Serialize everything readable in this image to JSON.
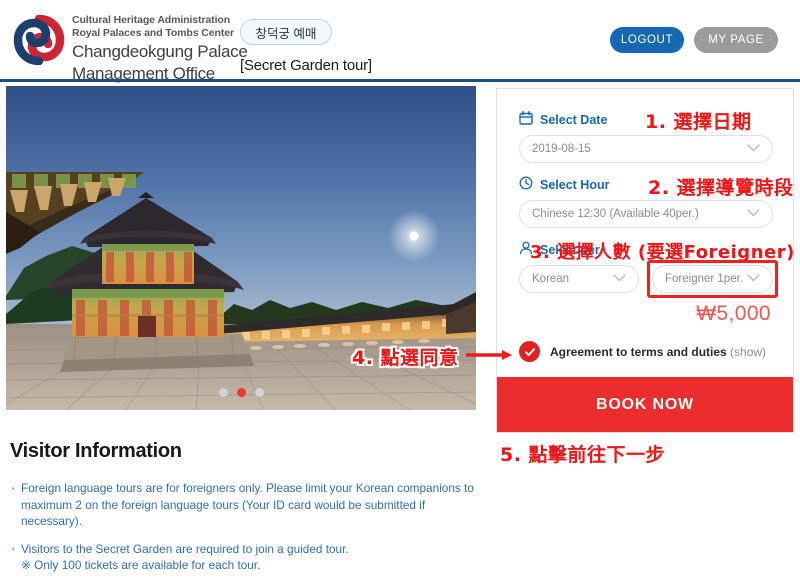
{
  "header": {
    "logo_icon": "korea-taegeuk-logo",
    "org_line1": "Cultural Heritage Administration",
    "org_line2": "Royal Palaces and Tombs Center",
    "org_main_line1": "Changdeokgung Palace",
    "org_main_line2": "Management Office",
    "korean_pill": "창덕궁 예매",
    "tour_title": "[Secret Garden tour]",
    "logout_label": "LOGOUT",
    "mypage_label": "MY PAGE",
    "rule_color": "#1b4f88"
  },
  "hero": {
    "alt": "Changdeokgung Palace Injeongjeon hall illuminated at dusk",
    "dots": [
      "inactive",
      "active",
      "inactive"
    ],
    "active_dot_color": "#e8392f"
  },
  "panel": {
    "date": {
      "icon": "calendar-icon",
      "label": "Select Date",
      "value": "2019-08-15",
      "chevron": "chevron-down-icon"
    },
    "hour": {
      "icon": "clock-icon",
      "label": "Select Hour",
      "value": "Chinese 12:30 (Available 40per.)",
      "chevron": "chevron-down-icon"
    },
    "persons": {
      "icon": "person-icon",
      "label": "Select per.",
      "language_value": "Korean",
      "foreigner_value": "Foreigner 1per.",
      "chevron": "chevron-down-icon",
      "highlight_color": "#ef2222"
    },
    "price": "₩5,000",
    "price_color": "#f3564e",
    "agreement": {
      "check_icon": "check-circle-icon",
      "text": "Agreement to terms and duties",
      "show_link": "(show)",
      "checked": true
    },
    "book_now_label": "BOOK NOW",
    "book_now_color": "#ec2d2d"
  },
  "visitor": {
    "heading": "Visitor Information",
    "items": [
      "Foreign language tours are for foreigners only. Please limit your Korean companions to maximum 2 on the foreign language tours (Your ID card would be submitted if necessary).",
      "Visitors to the Secret Garden are required to join a guided tour."
    ],
    "sub_note": "※ Only 100 tickets are available for each tour."
  },
  "annotations": {
    "color": "#f01414",
    "step1": "1. 選擇日期",
    "step2": "2. 選擇導覽時段",
    "step3": "3. 選擇人數 (要選Foreigner)",
    "step4": "4. 點選同意",
    "step5": "5. 點擊前往下一步",
    "arrow_icon": "right-arrow-icon"
  }
}
